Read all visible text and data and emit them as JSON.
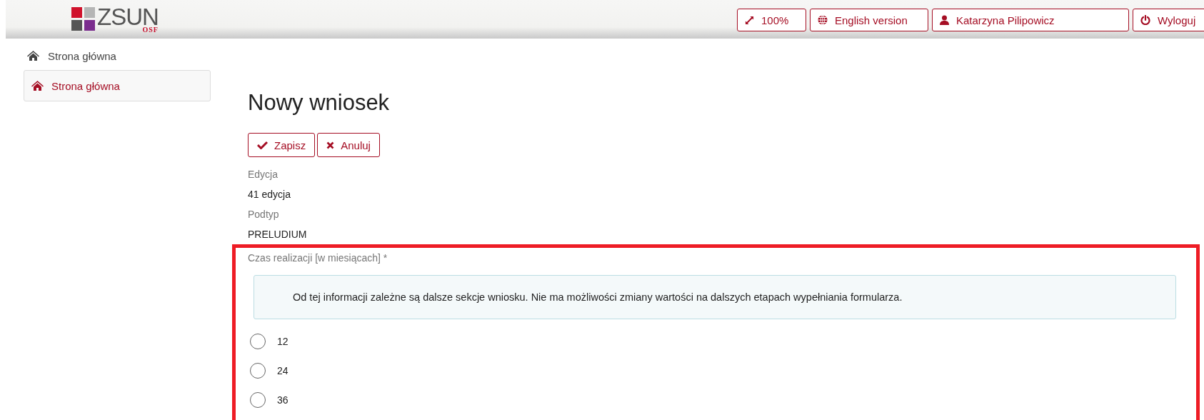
{
  "header": {
    "logo": {
      "text": "ZSUN",
      "subtext": "OSF"
    },
    "buttons": [
      {
        "kind": "zoom",
        "label": "100%"
      },
      {
        "kind": "language",
        "label": "English version"
      },
      {
        "kind": "user",
        "label": "Katarzyna Pilipowicz"
      },
      {
        "kind": "logout",
        "label": "Wyloguj"
      }
    ]
  },
  "breadcrumb": {
    "label": "Strona główna"
  },
  "sidebar": {
    "items": [
      {
        "label": "Strona główna",
        "selected": true
      }
    ]
  },
  "page": {
    "title": "Nowy wniosek",
    "actions": [
      {
        "kind": "save",
        "label": "Zapisz"
      },
      {
        "kind": "cancel",
        "label": "Anuluj"
      }
    ],
    "fields": [
      {
        "label": "Edycja",
        "value": "41 edycja"
      },
      {
        "label": "Podtyp",
        "value": "PRELUDIUM"
      }
    ],
    "duration": {
      "label": "Czas realizacji [w miesiącach] *",
      "highlighted": true,
      "info": "Od tej informacji zależne są dalsze sekcje wniosku. Nie ma możliwości zmiany wartości na dalszych etapach wypełniania formularza.",
      "options": [
        {
          "label": "12",
          "selected": false
        },
        {
          "label": "24",
          "selected": false
        },
        {
          "label": "36",
          "selected": false
        }
      ]
    }
  }
}
